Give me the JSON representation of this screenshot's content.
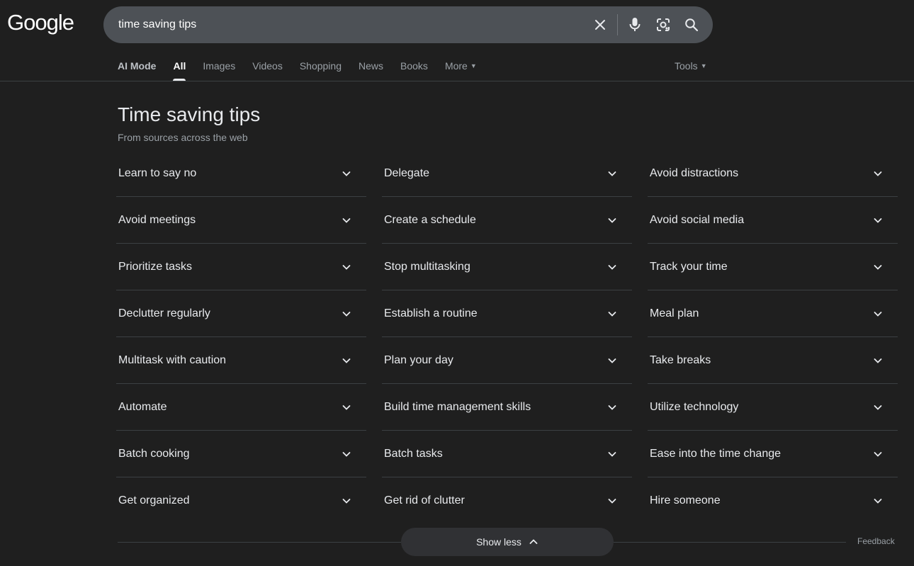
{
  "logo": "Google",
  "search": {
    "query": "time saving tips",
    "icons": [
      "close-icon",
      "microphone-icon",
      "lens-icon",
      "search-icon"
    ]
  },
  "tabs": [
    {
      "label": "AI Mode"
    },
    {
      "label": "All",
      "active": true
    },
    {
      "label": "Images"
    },
    {
      "label": "Videos"
    },
    {
      "label": "Shopping"
    },
    {
      "label": "News"
    },
    {
      "label": "Books"
    },
    {
      "label": "More"
    }
  ],
  "tools_label": "Tools",
  "section": {
    "title": "Time saving tips",
    "subtitle": "From sources across the web"
  },
  "items": [
    "Learn to say no",
    "Delegate",
    "Avoid distractions",
    "Avoid meetings",
    "Create a schedule",
    "Avoid social media",
    "Prioritize tasks",
    "Stop multitasking",
    "Track your time",
    "Declutter regularly",
    "Establish a routine",
    "Meal plan",
    "Multitask with caution",
    "Plan your day",
    "Take breaks",
    "Automate",
    "Build time management skills",
    "Utilize technology",
    "Batch cooking",
    "Batch tasks",
    "Ease into the time change",
    "Get organized",
    "Get rid of clutter",
    "Hire someone"
  ],
  "show_less_label": "Show less",
  "feedback_label": "Feedback",
  "colors": {
    "background": "#1f1f1f",
    "search_bar": "#4d5156",
    "text": "#e8eaed",
    "muted": "#9aa0a6",
    "divider": "#3c4043"
  }
}
